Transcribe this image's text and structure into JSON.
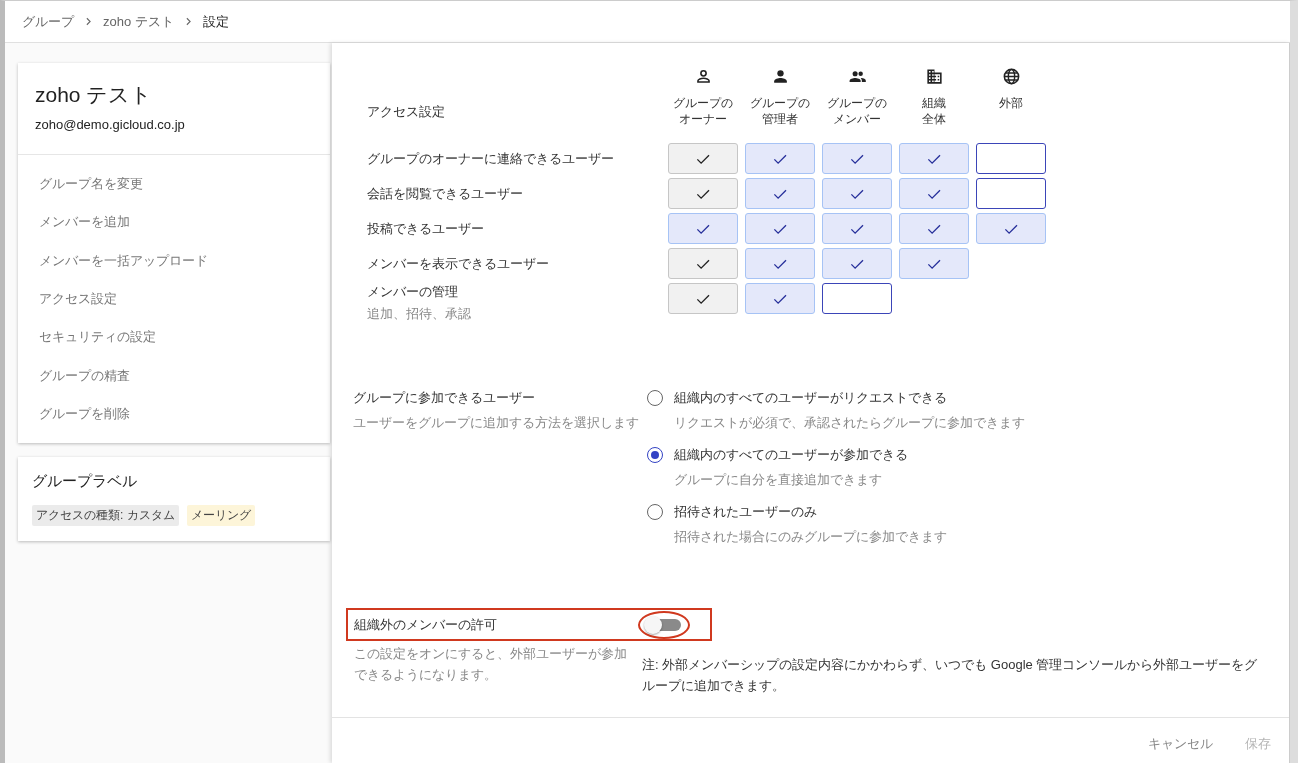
{
  "breadcrumb": [
    {
      "label": "グループ",
      "selected": false
    },
    {
      "label": "zoho テスト",
      "selected": false
    },
    {
      "label": "設定",
      "selected": true
    }
  ],
  "group_card": {
    "name": "zoho テスト",
    "email": "zoho@demo.gicloud.co.jp",
    "menu": [
      "グループ名を変更",
      "メンバーを追加",
      "メンバーを一括アップロード",
      "アクセス設定",
      "セキュリティの設定",
      "グループの精査",
      "グループを削除"
    ]
  },
  "labels_card": {
    "title": "グループラベル",
    "tags": [
      {
        "text": "アクセスの種類: カスタム",
        "color": "#ebebeb"
      },
      {
        "text": "メーリング",
        "color": "#fdf5d9"
      }
    ]
  },
  "access": {
    "title": "アクセス設定",
    "columns": [
      {
        "kind": "person-outline",
        "label_lines": [
          "グループの",
          "オーナー"
        ]
      },
      {
        "kind": "person",
        "label_lines": [
          "グループの",
          "管理者"
        ]
      },
      {
        "kind": "people",
        "label_lines": [
          "グループの",
          "メンバー"
        ]
      },
      {
        "kind": "building",
        "label_lines": [
          "組織",
          "全体"
        ]
      },
      {
        "kind": "globe",
        "label_lines": [
          "外部"
        ]
      }
    ],
    "rows": [
      {
        "label": "グループのオーナーに連絡できるユーザー",
        "cells": [
          {
            "checked": true,
            "disabled": true
          },
          {
            "checked": true,
            "disabled": false
          },
          {
            "checked": true,
            "disabled": false
          },
          {
            "checked": true,
            "disabled": false
          },
          {
            "checked": false,
            "disabled": false
          }
        ]
      },
      {
        "label": "会話を閲覧できるユーザー",
        "cells": [
          {
            "checked": true,
            "disabled": true
          },
          {
            "checked": true,
            "disabled": false
          },
          {
            "checked": true,
            "disabled": false
          },
          {
            "checked": true,
            "disabled": false
          },
          {
            "checked": false,
            "disabled": false
          }
        ]
      },
      {
        "label": "投稿できるユーザー",
        "cells": [
          {
            "checked": true,
            "disabled": false
          },
          {
            "checked": true,
            "disabled": false
          },
          {
            "checked": true,
            "disabled": false
          },
          {
            "checked": true,
            "disabled": false
          },
          {
            "checked": true,
            "disabled": false
          }
        ]
      },
      {
        "label": "メンバーを表示できるユーザー",
        "cells": [
          {
            "checked": true,
            "disabled": true
          },
          {
            "checked": true,
            "disabled": false
          },
          {
            "checked": true,
            "disabled": false
          },
          {
            "checked": true,
            "disabled": false
          }
        ]
      },
      {
        "label": "メンバーの管理",
        "sublabel": "追加、招待、承認",
        "cells": [
          {
            "checked": true,
            "disabled": true
          },
          {
            "checked": true,
            "disabled": false
          },
          {
            "checked": false,
            "disabled": false
          }
        ]
      }
    ]
  },
  "join": {
    "title": "グループに参加できるユーザー",
    "description": "ユーザーをグループに追加する方法を選択します",
    "options": [
      {
        "label": "組織内のすべてのユーザーがリクエストできる",
        "description": "リクエストが必須で、承認されたらグループに参加できます",
        "selected": false
      },
      {
        "label": "組織内のすべてのユーザーが参加できる",
        "description": "グループに自分を直接追加できます",
        "selected": true
      },
      {
        "label": "招待されたユーザーのみ",
        "description": "招待された場合にのみグループに参加できます",
        "selected": false
      }
    ]
  },
  "external": {
    "title": "組織外のメンバーの許可",
    "description": "この設定をオンにすると、外部ユーザーが参加できるようになります。",
    "on": false,
    "highlighted": true,
    "note": "注: 外部メンバーシップの設定内容にかかわらず、いつでも Google 管理コンソールから外部ユーザーをグループに追加できます。"
  },
  "footer": {
    "buttons": [
      {
        "label": "キャンセル",
        "disabled": false
      },
      {
        "label": "保存",
        "disabled": true
      }
    ]
  }
}
